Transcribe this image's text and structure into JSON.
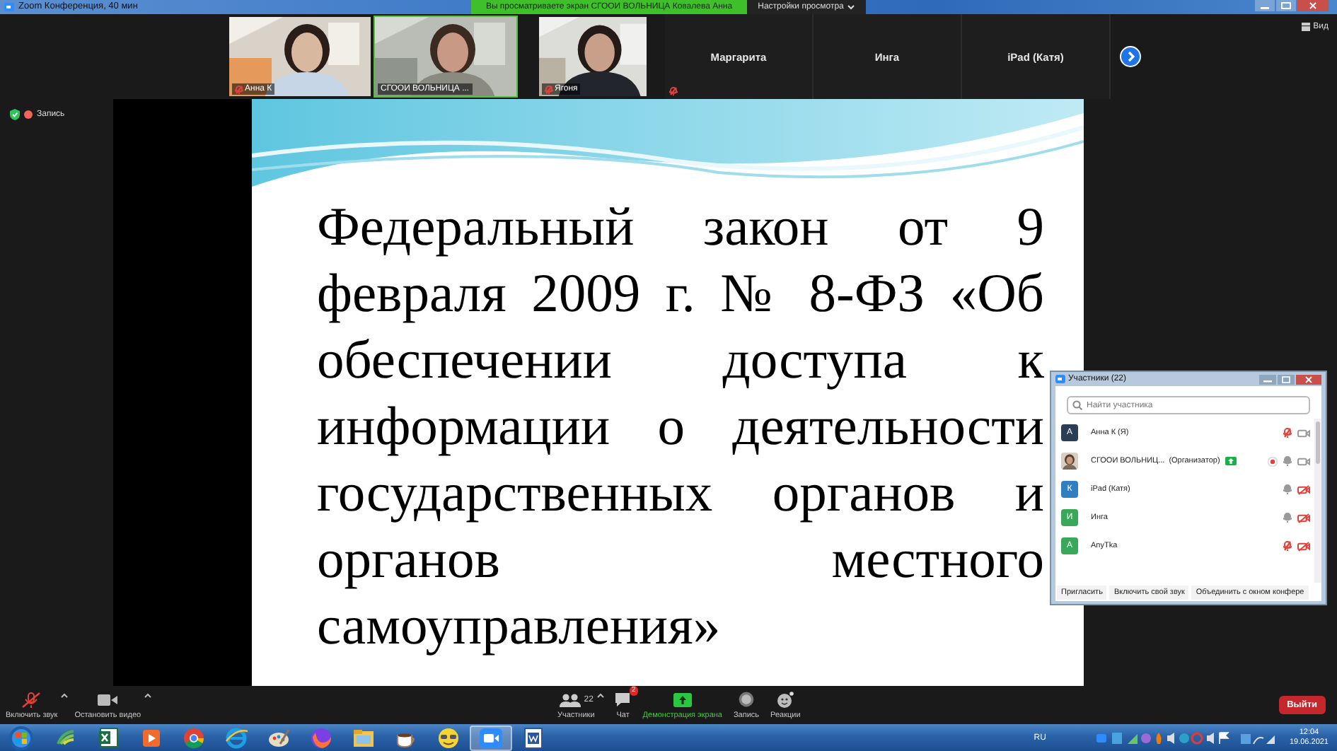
{
  "window": {
    "title": "Zoom Конференция, 40 мин"
  },
  "share_banner": {
    "text": "Вы просматриваете экран СГООИ ВОЛЬНИЦА Ковалева Анна",
    "view_options": "Настройки просмотра"
  },
  "video_tiles": [
    {
      "kind": "video",
      "name": "Анна К",
      "muted": true,
      "speaking": false
    },
    {
      "kind": "video",
      "name": "СГООИ ВОЛЬНИЦА ...",
      "muted": false,
      "speaking": true
    },
    {
      "kind": "video",
      "name": "Ягоня",
      "muted": true,
      "speaking": false
    },
    {
      "kind": "name",
      "name": "Маргарита",
      "muted": true,
      "speaking": false
    },
    {
      "kind": "name",
      "name": "Инга",
      "muted": false,
      "speaking": false
    },
    {
      "kind": "name",
      "name": "iPad (Катя)",
      "muted": false,
      "speaking": false
    }
  ],
  "view_button": "Вид",
  "recording": {
    "label": "Запись"
  },
  "slide": {
    "text": "Федеральный закон от 9 февраля 2009 г. № 8-ФЗ «Об обеспечении доступа к информации о деятельности государственных органов и органов местного самоуправления»"
  },
  "participants_panel": {
    "title": "Участники (22)",
    "search_placeholder": "Найти участника",
    "participants": [
      {
        "kind": "letter",
        "initial": "А",
        "color": "#2c3e55",
        "name": "Анна К (Я)",
        "muted": true,
        "video_off": false
      },
      {
        "kind": "picture",
        "name": "СГООИ ВОЛЬНИЦ...",
        "role": "(Организатор)",
        "sharing": true,
        "recording": true,
        "muted": false,
        "video_off": false
      },
      {
        "kind": "letter",
        "initial": "К",
        "color": "#2f7fc1",
        "name": "iPad (Катя)",
        "muted": false,
        "video_off": true
      },
      {
        "kind": "letter",
        "initial": "И",
        "color": "#3aa85a",
        "name": "Инга",
        "muted": false,
        "video_off": true
      },
      {
        "kind": "letter",
        "initial": "А",
        "color": "#3aa85a",
        "name": "AnyTka",
        "muted": true,
        "video_off": true
      }
    ],
    "buttons": [
      "Пригласить",
      "Включить свой звук",
      "Объединить с окном конфере"
    ]
  },
  "toolbar": {
    "left": [
      {
        "kind": "mic",
        "label": "Включить звук",
        "muted": true
      },
      {
        "kind": "camera",
        "label": "Остановить видео"
      }
    ],
    "center": [
      {
        "kind": "participants",
        "label": "Участники",
        "count": "22"
      },
      {
        "kind": "chat",
        "label": "Чат",
        "badge": "2"
      },
      {
        "kind": "share",
        "label": "Демонстрация экрана"
      },
      {
        "kind": "record",
        "label": "Запись"
      },
      {
        "kind": "reactions",
        "label": "Реакции"
      }
    ],
    "leave": "Выйти"
  },
  "taskbar": {
    "apps": [
      {
        "kind": "signal",
        "selected": false
      },
      {
        "kind": "sheet",
        "selected": false
      },
      {
        "kind": "player",
        "selected": false
      },
      {
        "kind": "browser-ring",
        "selected": false
      },
      {
        "kind": "browser-e",
        "selected": false
      },
      {
        "kind": "paint",
        "selected": false
      },
      {
        "kind": "fox",
        "selected": false
      },
      {
        "kind": "folder",
        "selected": false
      },
      {
        "kind": "cup",
        "selected": false
      },
      {
        "kind": "smiley",
        "selected": false
      },
      {
        "kind": "camera",
        "selected": true
      },
      {
        "kind": "document",
        "selected": false
      }
    ],
    "language": "RU",
    "time": "12:04",
    "date": "19.06.2021"
  }
}
